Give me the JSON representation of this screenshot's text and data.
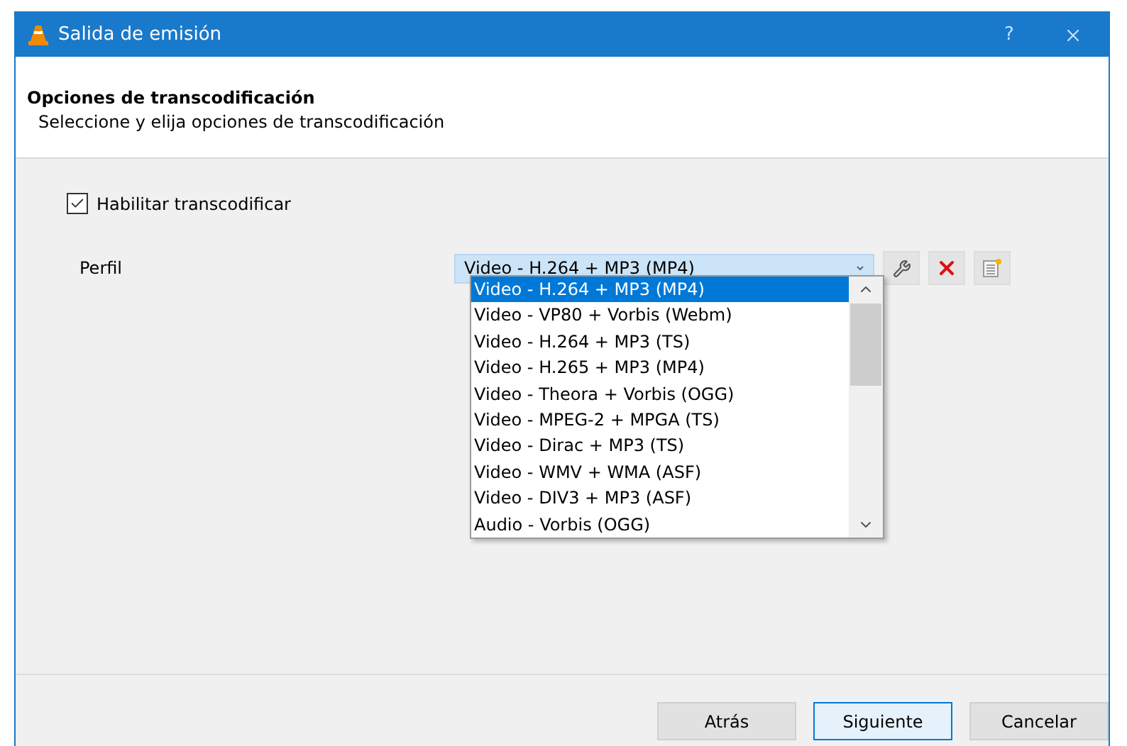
{
  "window": {
    "title": "Salida de emisión",
    "help": "?"
  },
  "header": {
    "title": "Opciones de transcodificación",
    "subtitle": "Seleccione y elija opciones de transcodificación"
  },
  "enable_transcode": {
    "label": "Habilitar transcodificar",
    "checked": true
  },
  "profile": {
    "label": "Perfil",
    "value": "Video - H.264 + MP3 (MP4)",
    "expanded": true,
    "options": [
      {
        "label": "Video - H.264 + MP3 (MP4)",
        "selected": true
      },
      {
        "label": "Video - VP80 + Vorbis (Webm)",
        "selected": false
      },
      {
        "label": "Video - H.264 + MP3 (TS)",
        "selected": false
      },
      {
        "label": "Video - H.265 + MP3 (MP4)",
        "selected": false
      },
      {
        "label": "Video - Theora + Vorbis (OGG)",
        "selected": false
      },
      {
        "label": "Video - MPEG-2 + MPGA (TS)",
        "selected": false
      },
      {
        "label": "Video - Dirac + MP3 (TS)",
        "selected": false
      },
      {
        "label": "Video - WMV + WMA (ASF)",
        "selected": false
      },
      {
        "label": "Video - DIV3 + MP3 (ASF)",
        "selected": false
      },
      {
        "label": "Audio - Vorbis (OGG)",
        "selected": false
      }
    ]
  },
  "buttons": [
    {
      "label": "Atrás",
      "selected": false
    },
    {
      "label": "Siguiente",
      "selected": true
    },
    {
      "label": "Cancelar",
      "selected": false
    }
  ]
}
